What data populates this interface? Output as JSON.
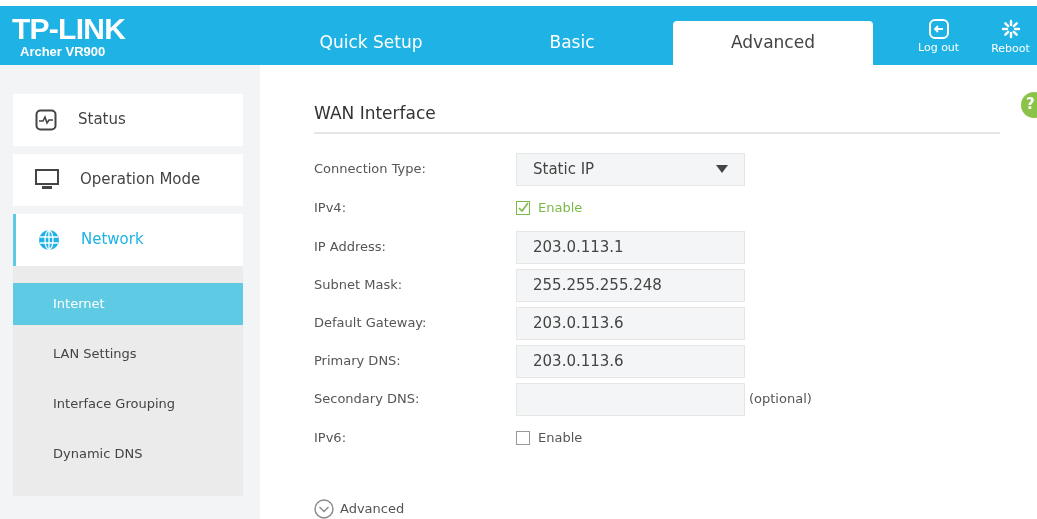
{
  "header": {
    "logo": "TP-LINK",
    "model": "Archer VR900",
    "tabs": [
      {
        "label": "Quick Setup",
        "selected": false
      },
      {
        "label": "Basic",
        "selected": false
      },
      {
        "label": "Advanced",
        "selected": true
      }
    ],
    "actions": [
      {
        "kind": "logout",
        "label": "Log out"
      },
      {
        "kind": "reboot",
        "label": "Reboot"
      }
    ]
  },
  "sidebar": {
    "items": [
      {
        "kind": "status",
        "label": "Status",
        "selected": false
      },
      {
        "kind": "monitor",
        "label": "Operation Mode",
        "selected": false
      },
      {
        "kind": "globe",
        "label": "Network",
        "selected": true,
        "children": [
          {
            "label": "Internet",
            "selected": true
          },
          {
            "label": "LAN Settings",
            "selected": false
          },
          {
            "label": "Interface Grouping",
            "selected": false
          },
          {
            "label": "Dynamic DNS",
            "selected": false
          }
        ]
      }
    ]
  },
  "content": {
    "title": "WAN Interface",
    "help": "?",
    "fields": [
      {
        "kind": "select",
        "label": "Connection Type:",
        "value": "Static IP"
      },
      {
        "kind": "checkbox",
        "label": "IPv4:",
        "text": "Enable",
        "checked": true
      },
      {
        "kind": "text",
        "label": "IP Address:",
        "value": "203.0.113.1"
      },
      {
        "kind": "text",
        "label": "Subnet Mask:",
        "value": "255.255.255.248"
      },
      {
        "kind": "text",
        "label": "Default Gateway:",
        "value": "203.0.113.6"
      },
      {
        "kind": "text",
        "label": "Primary DNS:",
        "value": "203.0.113.6"
      },
      {
        "kind": "text",
        "label": "Secondary DNS:",
        "note": "(optional)"
      },
      {
        "kind": "checkbox",
        "label": "IPv6:",
        "text": "Enable",
        "checked": false
      }
    ],
    "advanced": "Advanced"
  }
}
